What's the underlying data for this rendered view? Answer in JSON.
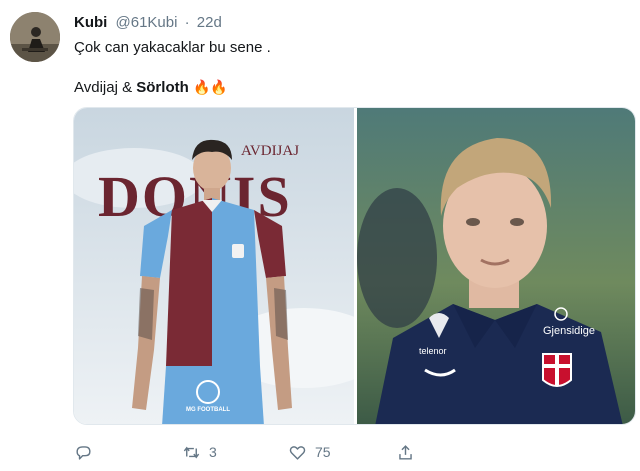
{
  "tweet": {
    "author_name": "Kubi",
    "author_handle": "@61Kubi",
    "separator": "·",
    "time": "22d",
    "text_line1": "Çok can yakacaklar bu sene .",
    "text_line2_prefix": "Avdijaj & ",
    "text_line2_bold": "Sörloth",
    "text_line2_emoji": "🔥🔥"
  },
  "media": {
    "left_image_caption_small": "AVDIJAJ",
    "left_image_caption_large": "DONIS",
    "left_image_watermark": "MG FOOTBALL",
    "right_image_text_brand": "Gjensidige",
    "right_image_text_sponsor": "telenor"
  },
  "actions": {
    "reply_icon": "reply-icon",
    "retweet_icon": "retweet-icon",
    "retweet_count": "3",
    "like_icon": "heart-icon",
    "like_count": "75",
    "share_icon": "share-icon"
  },
  "colors": {
    "secondary_text": "#657786",
    "primary_text": "#14171a",
    "trabzon_claret": "#7a2a35",
    "trabzon_blue": "#6aa9dd",
    "norway_navy": "#1b2a52"
  }
}
